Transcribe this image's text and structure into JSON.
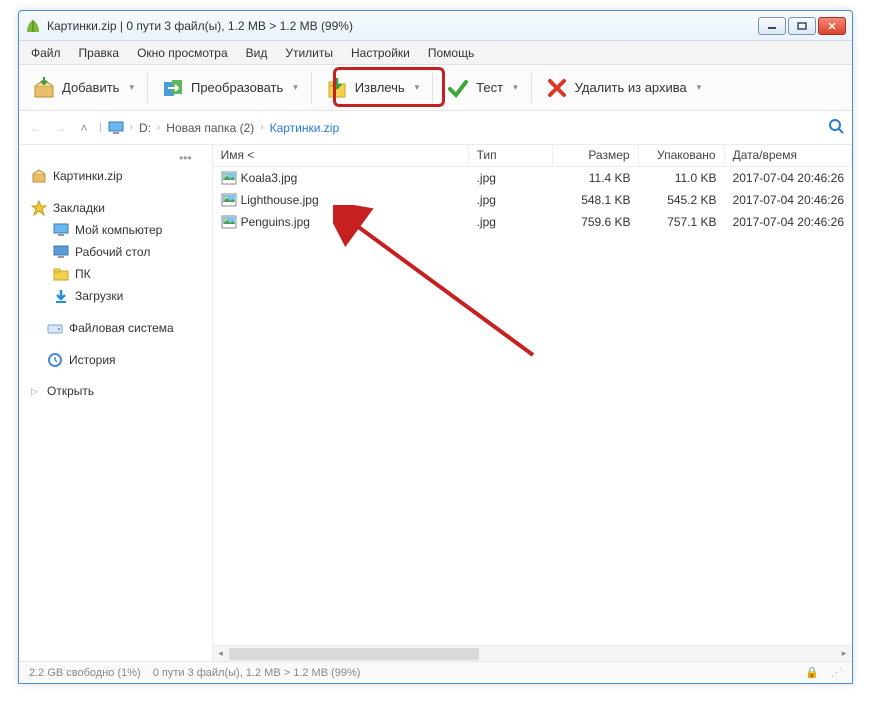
{
  "title": "Картинки.zip | 0 пути 3 файл(ы), 1.2 MB > 1.2 MB (99%)",
  "menu": {
    "file": "Файл",
    "edit": "Правка",
    "view_window": "Окно просмотра",
    "view": "Вид",
    "tools": "Утилиты",
    "settings": "Настройки",
    "help": "Помощь"
  },
  "toolbar": {
    "add": "Добавить",
    "convert": "Преобразовать",
    "extract": "Извлечь",
    "test": "Тест",
    "delete": "Удалить из архива"
  },
  "breadcrumb": {
    "drive": "D:",
    "folder": "Новая папка (2)",
    "archive": "Картинки.zip"
  },
  "sidebar": {
    "archive": "Картинки.zip",
    "bookmarks": "Закладки",
    "items": [
      {
        "label": "Мой компьютер"
      },
      {
        "label": "Рабочий стол"
      },
      {
        "label": "ПК"
      },
      {
        "label": "Загрузки"
      }
    ],
    "filesystem": "Файловая система",
    "history": "История",
    "open": "Открыть"
  },
  "columns": {
    "name": "Имя <",
    "type": "Тип",
    "size": "Размер",
    "packed": "Упаковано",
    "date": "Дата/время"
  },
  "files": [
    {
      "name": "Koala3.jpg",
      "type": ".jpg",
      "size": "11.4 KB",
      "packed": "11.0 KB",
      "date": "2017-07-04 20:46:26"
    },
    {
      "name": "Lighthouse.jpg",
      "type": ".jpg",
      "size": "548.1 KB",
      "packed": "545.2 KB",
      "date": "2017-07-04 20:46:26"
    },
    {
      "name": "Penguins.jpg",
      "type": ".jpg",
      "size": "759.6 KB",
      "packed": "757.1 KB",
      "date": "2017-07-04 20:46:26"
    }
  ],
  "status": {
    "free": "2.2 GB свободно (1%)",
    "info": "0 пути 3 файл(ы), 1.2 MB > 1.2 MB (99%)"
  }
}
